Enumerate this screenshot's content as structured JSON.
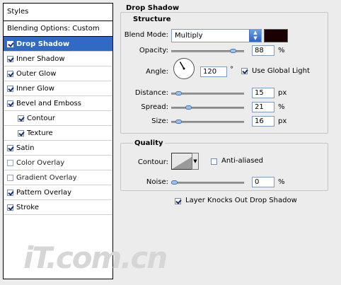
{
  "styles_panel": {
    "header": "Styles",
    "blending_options": "Blending Options: Custom",
    "items": [
      {
        "label": "Drop Shadow",
        "checked": true,
        "selected": true,
        "indent": false
      },
      {
        "label": "Inner Shadow",
        "checked": true,
        "selected": false,
        "indent": false
      },
      {
        "label": "Outer Glow",
        "checked": true,
        "selected": false,
        "indent": false
      },
      {
        "label": "Inner Glow",
        "checked": true,
        "selected": false,
        "indent": false
      },
      {
        "label": "Bevel and Emboss",
        "checked": true,
        "selected": false,
        "indent": false
      },
      {
        "label": "Contour",
        "checked": true,
        "selected": false,
        "indent": true
      },
      {
        "label": "Texture",
        "checked": true,
        "selected": false,
        "indent": true
      },
      {
        "label": "Satin",
        "checked": true,
        "selected": false,
        "indent": false
      },
      {
        "label": "Color Overlay",
        "checked": false,
        "selected": false,
        "indent": false
      },
      {
        "label": "Gradient Overlay",
        "checked": false,
        "selected": false,
        "indent": false
      },
      {
        "label": "Pattern Overlay",
        "checked": true,
        "selected": false,
        "indent": false
      },
      {
        "label": "Stroke",
        "checked": true,
        "selected": false,
        "indent": false
      }
    ]
  },
  "drop_shadow": {
    "title": "Drop Shadow",
    "structure": {
      "title": "Structure",
      "blend_mode_label": "Blend Mode:",
      "blend_mode_value": "Multiply",
      "shadow_color": "#1a0000",
      "opacity_label": "Opacity:",
      "opacity_value": "88",
      "opacity_unit": "%",
      "opacity_fraction": 0.88,
      "angle_label": "Angle:",
      "angle_value": "120",
      "angle_unit": "°",
      "use_global_light_label": "Use Global Light",
      "use_global_light_checked": true,
      "distance_label": "Distance:",
      "distance_value": "15",
      "distance_unit": "px",
      "distance_fraction": 0.06,
      "spread_label": "Spread:",
      "spread_value": "21",
      "spread_unit": "%",
      "spread_fraction": 0.21,
      "size_label": "Size:",
      "size_value": "16",
      "size_unit": "px",
      "size_fraction": 0.06
    },
    "quality": {
      "title": "Quality",
      "contour_label": "Contour:",
      "anti_aliased_label": "Anti-aliased",
      "anti_aliased_checked": false,
      "noise_label": "Noise:",
      "noise_value": "0",
      "noise_unit": "%",
      "noise_fraction": 0.0
    },
    "layer_knocks_out_label": "Layer Knocks Out Drop Shadow",
    "layer_knocks_out_checked": true
  },
  "watermark": "iT.com.cn",
  "accent_color": "#316ac5"
}
